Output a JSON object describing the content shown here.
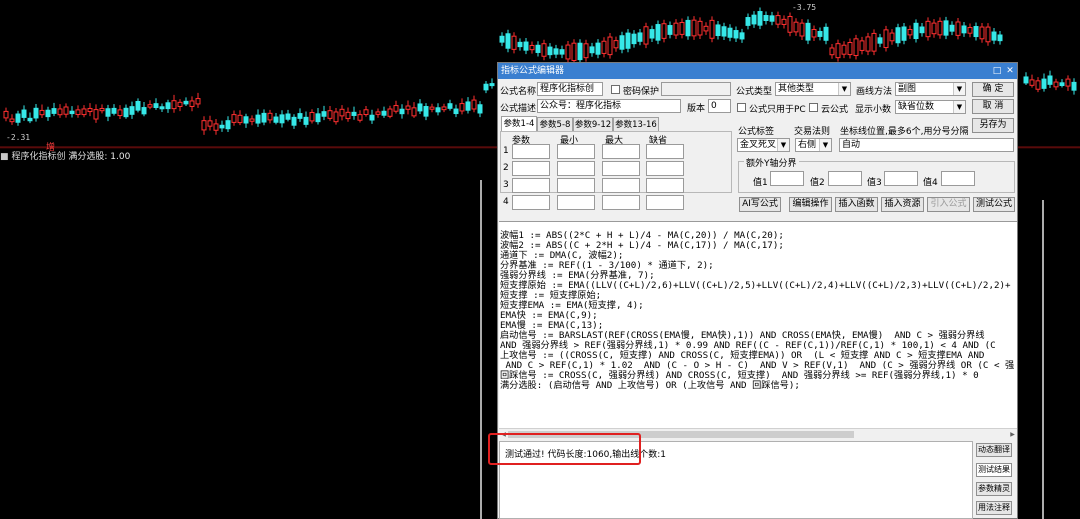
{
  "chart": {
    "indicator_label": "程序化指标创",
    "indicator_value_text": "满分选股: 1.00",
    "price_low_label": "2.31",
    "price_high_label": "3.75",
    "bottom_marker": "增"
  },
  "editor": {
    "title": "指标公式编辑器",
    "formula_name_label": "公式名称",
    "formula_name_value": "程序化指标创",
    "password_protect_label": "密码保护",
    "formula_desc_label": "公式描述",
    "formula_desc_value": "公众号：程序化指标",
    "version_label": "版本",
    "version_value": "0",
    "formula_type_label": "公式类型",
    "formula_type_value": "其他类型",
    "draw_method_label": "画线方法",
    "draw_method_value": "副图",
    "ok_button": "确 定",
    "cancel_button": "取 消",
    "pc_only_label": "公式只用于PC",
    "cloud_label": "云公式",
    "show_decimals_label": "显示小数",
    "show_decimals_value": "缺省位数",
    "save_as_button": "另存为",
    "tabs": [
      "参数1-4",
      "参数5-8",
      "参数9-12",
      "参数13-16"
    ],
    "param_headers": [
      "参数",
      "最小",
      "最大",
      "缺省"
    ],
    "param_rows": [
      "1",
      "2",
      "3",
      "4"
    ],
    "formula_tag_label": "公式标签",
    "formula_tag_value": "金叉死叉",
    "trade_rule_label": "交易法则",
    "trade_rule_value": "右侧",
    "axis_pos_label": "坐标线位置,最多6个,用分号分隔",
    "axis_pos_value": "自动",
    "extra_axis_label": "额外Y轴分界",
    "value_labels": [
      "值1",
      "值2",
      "值3",
      "值4"
    ],
    "buttons": {
      "ai": "AI写公式",
      "edit": "编辑操作",
      "insert_func": "插入函数",
      "insert_res": "插入资源",
      "import": "引入公式",
      "test": "测试公式"
    },
    "code_lines": [
      "波幅1 := ABS((2*C + H + L)/4 - MA(C,20)) / MA(C,20);",
      "波幅2 := ABS((C + 2*H + L)/4 - MA(C,17)) / MA(C,17);",
      "通道下 := DMA(C, 波幅2);",
      "分界基准 := REF((1 - 3/100) * 通道下, 2);",
      "强弱分界线 := EMA(分界基准, 7);",
      "短支撑原始 := EMA((LLV((C+L)/2,6)+LLV((C+L)/2,5)+LLV((C+L)/2,4)+LLV((C+L)/2,3)+LLV((C+L)/2,2)+",
      "短支撑 := 短支撑原始;",
      "短支撑EMA := EMA(短支撑, 4);",
      "EMA快 := EMA(C,9);",
      "EMA慢 := EMA(C,13);",
      "启动信号 := BARSLAST(REF(CROSS(EMA慢, EMA快),1)) AND CROSS(EMA快, EMA慢)  AND C > 强弱分界线",
      "AND 强弱分界线 > REF(强弱分界线,1) * 0.99 AND REF((C - REF(C,1))/REF(C,1) * 100,1) < 4 AND (C",
      "上攻信号 := ((CROSS(C, 短支撑) AND CROSS(C, 短支撑EMA)) OR  (L < 短支撑 AND C > 短支撑EMA AND",
      " AND C > REF(C,1) * 1.02  AND (C - O > H - C)  AND V > REF(V,1)  AND (C > 强弱分界线 OR (C < 强",
      "回踩信号 := CROSS(C, 强弱分界线) AND CROSS(C, 短支撑)  AND 强弱分界线 >= REF(强弱分界线,1) * 0",
      "满分选股: (启动信号 AND 上攻信号) OR (上攻信号 AND 回踩信号);"
    ],
    "status_text": "测试通过! 代码长度:1060,输出线个数:1",
    "side_buttons": [
      "动态翻译",
      "测试结果",
      "参数精灵",
      "用法注释"
    ]
  }
}
